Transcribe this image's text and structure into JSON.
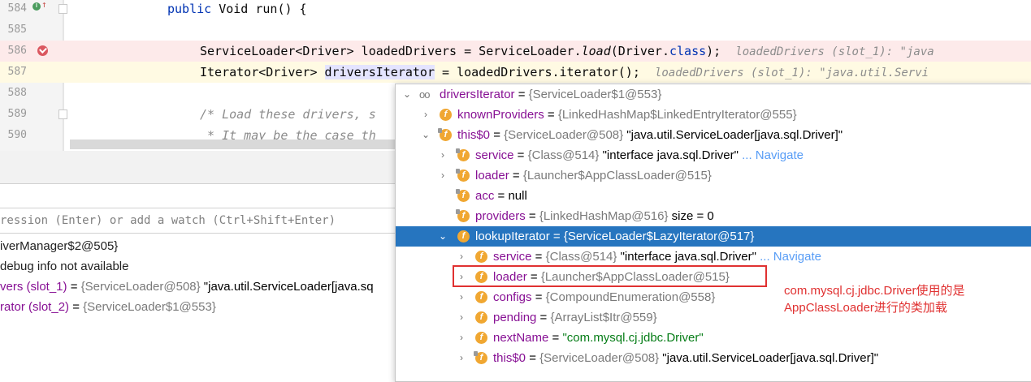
{
  "editor": {
    "lines": [
      {
        "num": "584",
        "seg_kw": "public",
        "seg_type": " Void ",
        "seg_name": "run() {"
      },
      {
        "num": "585"
      },
      {
        "num": "586",
        "code_a": "ServiceLoader<Driver> loadedDrivers = ServiceLoader.",
        "code_method": "load",
        "code_b": "(Driver.",
        "code_kw": "class",
        "code_c": ");",
        "hint": "loadedDrivers (slot_1): \"java"
      },
      {
        "num": "587",
        "code_a": "Iterator<Driver> ",
        "code_sel": "driversIterator",
        "code_b": " = loadedDrivers.iterator();",
        "hint": "loadedDrivers (slot_1): \"java.util.Servi"
      },
      {
        "num": "588"
      },
      {
        "num": "589",
        "comment": "/* Load these drivers, s"
      },
      {
        "num": "590",
        "comment": " * It may be the case th"
      }
    ]
  },
  "evaluate": {
    "placeholder": "ression (Enter) or add a watch (Ctrl+Shift+Enter)"
  },
  "frames": [
    {
      "text": "iverManager$2@505}"
    },
    {
      "text": " debug info not available"
    },
    {
      "name": "vers (slot_1)",
      "eq": " = ",
      "ref": "{ServiceLoader@508}",
      "val": " \"java.util.ServiceLoader[java.sq"
    },
    {
      "name": "rator (slot_2)",
      "eq": " = ",
      "ref": "{ServiceLoader$1@553}"
    }
  ],
  "popup": {
    "rows": [
      {
        "name": "driversIterator",
        "eq": " = ",
        "ref": "{ServiceLoader$1@553}"
      },
      {
        "name": "knownProviders",
        "eq": " = ",
        "ref": "{LinkedHashMap$LinkedEntryIterator@555}"
      },
      {
        "name": "this$0",
        "eq": " = ",
        "ref": "{ServiceLoader@508}",
        "val": " \"java.util.ServiceLoader[java.sql.Driver]\""
      },
      {
        "name": "service",
        "eq": " = ",
        "ref": "{Class@514}",
        "val": " \"interface java.sql.Driver\"",
        "link": " ... Navigate"
      },
      {
        "name": "loader",
        "eq": " = ",
        "ref": "{Launcher$AppClassLoader@515}"
      },
      {
        "name": "acc",
        "eq": " = ",
        "val": "null"
      },
      {
        "name": "providers",
        "eq": " = ",
        "ref": "{LinkedHashMap@516}",
        "val": "  size = 0"
      },
      {
        "name": "lookupIterator",
        "eq": " = ",
        "ref": "{ServiceLoader$LazyIterator@517}"
      },
      {
        "name": "service",
        "eq": " = ",
        "ref": "{Class@514}",
        "val": " \"interface java.sql.Driver\"",
        "link": " ... Navigate"
      },
      {
        "name": "loader",
        "eq": " = ",
        "ref": "{Launcher$AppClassLoader@515}"
      },
      {
        "name": "configs",
        "eq": " = ",
        "ref": "{CompoundEnumeration@558}"
      },
      {
        "name": "pending",
        "eq": " = ",
        "ref": "{ArrayList$Itr@559}"
      },
      {
        "name": "nextName",
        "eq": " = ",
        "str": "\"com.mysql.cj.jdbc.Driver\""
      },
      {
        "name": "this$0",
        "eq": " = ",
        "ref": "{ServiceLoader@508}",
        "val": " \"java.util.ServiceLoader[java.sql.Driver]\""
      }
    ]
  },
  "annotation": {
    "line1": "com.mysql.cj.jdbc.Driver使用的是",
    "line2": "AppClassLoader进行的类加载"
  },
  "colors": {
    "selection": "#2675bf",
    "breakpoint": "#db5860",
    "annotation": "#e03131",
    "field_icon": "#f0a732"
  }
}
